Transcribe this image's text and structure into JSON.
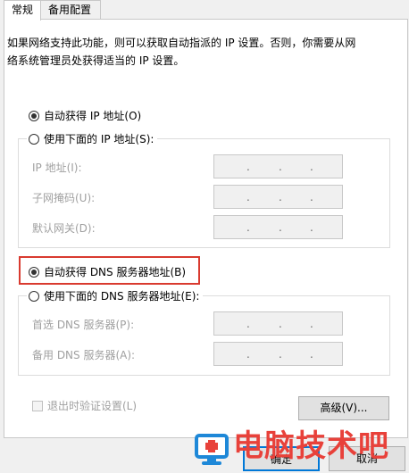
{
  "tabs": [
    {
      "label": "常规",
      "active": true
    },
    {
      "label": "备用配置",
      "active": false
    }
  ],
  "description": [
    "如果网络支持此功能，则可以获取自动指派的 IP 设置。否则，你需要从网",
    "络系统管理员处获得适当的 IP 设置。"
  ],
  "ip": {
    "auto_option": {
      "label": "自动获得 IP 地址(O)",
      "selected": true
    },
    "manual_option": {
      "label": "使用下面的 IP 地址(S):",
      "selected": false
    },
    "fields": [
      {
        "label": "IP 地址(I):",
        "dots": [
          ".",
          ".",
          "."
        ]
      },
      {
        "label": "子网掩码(U):",
        "dots": [
          ".",
          ".",
          "."
        ]
      },
      {
        "label": "默认网关(D):",
        "dots": [
          ".",
          ".",
          "."
        ]
      }
    ]
  },
  "dns": {
    "auto_option": {
      "label": "自动获得 DNS 服务器地址(B)",
      "selected": true
    },
    "manual_option": {
      "label": "使用下面的 DNS 服务器地址(E):",
      "selected": false
    },
    "fields": [
      {
        "label": "首选 DNS 服务器(P):",
        "dots": [
          ".",
          ".",
          "."
        ]
      },
      {
        "label": "备用 DNS 服务器(A):",
        "dots": [
          ".",
          ".",
          "."
        ]
      }
    ]
  },
  "validate_checkbox": {
    "label": "退出时验证设置(L)",
    "checked": false
  },
  "buttons": {
    "advanced": "高级(V)...",
    "ok": "确定",
    "cancel": "取消"
  },
  "watermark": {
    "text": "电脑技术吧",
    "icon": "monitor-plus-logo"
  },
  "colors": {
    "highlight": "#d93a2f",
    "watermark": "#e8413a",
    "watermark_icon": "#1e88d8"
  }
}
